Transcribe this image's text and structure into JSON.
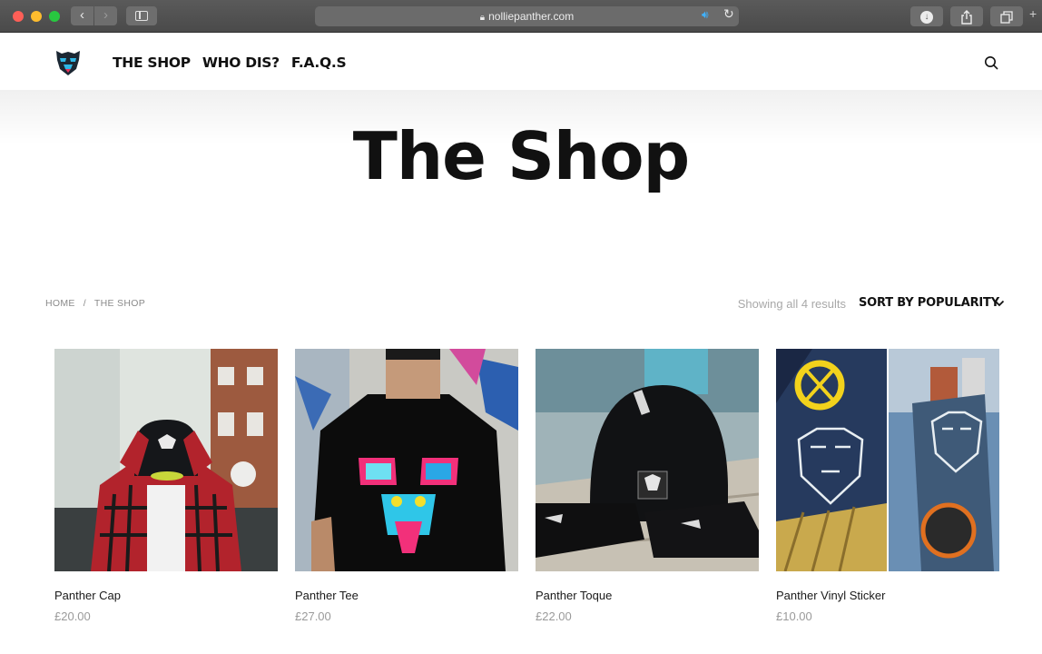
{
  "browser": {
    "url": "nolliepanther.com",
    "back_glyph": "‹",
    "forward_glyph": "›"
  },
  "site": {
    "nav": [
      "THE SHOP",
      "WHO DIS?",
      "F.A.Q.S"
    ]
  },
  "hero": {
    "title": "The Shop"
  },
  "breadcrumb": {
    "items": [
      "HOME",
      "THE SHOP"
    ],
    "separator": "/"
  },
  "toolbar": {
    "results_text": "Showing all 4 results",
    "sort_label": "SORT BY POPULARITY"
  },
  "products": [
    {
      "name": "Panther Cap",
      "price": "£20.00"
    },
    {
      "name": "Panther Tee",
      "price": "£27.00"
    },
    {
      "name": "Panther Toque",
      "price": "£22.00"
    },
    {
      "name": "Panther Vinyl Sticker",
      "price": "£10.00"
    }
  ],
  "colors": {
    "text": "#111111",
    "muted": "#9a9a9a",
    "audio_accent": "#3fb2ff"
  }
}
